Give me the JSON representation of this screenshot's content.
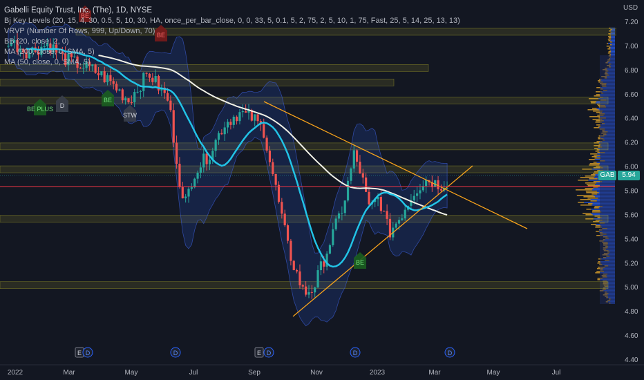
{
  "legend": {
    "title": "Gabelli Equity Trust, Inc. (The), 1D, NYSE",
    "lines": [
      "Bj Key Levels (20, 15, 4, 30, 0.5, 5, 10, 30, HA, once_per_bar_close, 0, 0, 33, 5, 0.1, 5, 2, 75, 2, 5, 10, 1, 75, Fast, 25, 5, 14, 25, 13, 13)",
      "VRVP (Number Of Rows, 999, Up/Down, 70)",
      "BB (20, close, 2, 0)",
      "MA (200, close, 0, SMA, 5)",
      "MA (50, close, 0, SMA, 5)"
    ]
  },
  "price_axis": {
    "currency": "USD",
    "ticks": [
      "7.20",
      "7.00",
      "6.80",
      "6.60",
      "6.40",
      "6.20",
      "6.00",
      "5.80",
      "5.60",
      "5.40",
      "5.20",
      "5.00",
      "4.80",
      "4.60",
      "4.40"
    ],
    "current_price": "5.94",
    "symbol_tag": "GAB"
  },
  "time_axis": {
    "ticks": [
      "2022",
      "Mar",
      "May",
      "Jul",
      "Sep",
      "Nov",
      "2023",
      "Mar",
      "May",
      "Jul"
    ]
  },
  "signals": [
    {
      "label": "BE",
      "kind": "sell"
    },
    {
      "label": "BE",
      "kind": "sell"
    },
    {
      "label": "BE PLUS",
      "kind": "buy"
    },
    {
      "label": "D",
      "kind": "neutral"
    },
    {
      "label": "BE",
      "kind": "buy"
    },
    {
      "label": "STW",
      "kind": "neutral"
    },
    {
      "label": "BE",
      "kind": "buy"
    }
  ],
  "events": [
    "E",
    "D",
    "D",
    "E",
    "D",
    "D",
    "D"
  ],
  "colors": {
    "background": "#131722",
    "up": "#26a69a",
    "down": "#ef5350",
    "ma50": "#22c3e6",
    "ma200": "#f0f0e6",
    "bb_fill": "#2962ff",
    "trendline": "#f7a21b",
    "key_level": "#b8b42a",
    "price_line": "#f23645"
  }
}
